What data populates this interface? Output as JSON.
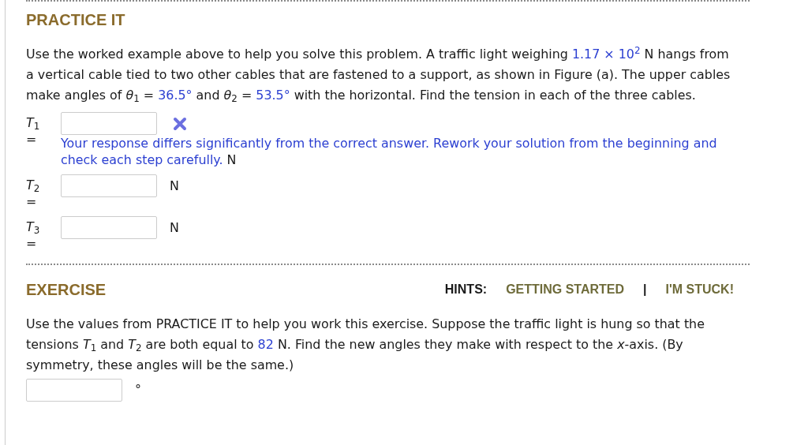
{
  "practice": {
    "title": "PRACTICE IT",
    "paragraph": [
      {
        "kind": "plain",
        "text": "Use the worked example above to help you solve this problem. A traffic light weighing "
      },
      {
        "kind": "value",
        "text": "1.17 × 10$^{2}$"
      },
      {
        "kind": "plain",
        "text": " N hangs from a vertical cable tied to two other cables that are fastened to a support, as shown in Figure (a). The upper cables make angles of *θ*$_{1}$ = "
      },
      {
        "kind": "value",
        "text": "36.5°"
      },
      {
        "kind": "plain",
        "text": " and *θ*$_{2}$ = "
      },
      {
        "kind": "value",
        "text": "53.5°"
      },
      {
        "kind": "plain",
        "text": " with the horizontal. Find the tension in each of the three cables."
      }
    ],
    "answers": [
      {
        "label": "*T*$_{1}$ =",
        "incorrect": true,
        "feedback": "Your response differs significantly from the correct answer. Rework your solution from the beginning and check each step carefully.",
        "unit": "N"
      },
      {
        "label": "*T*$_{2}$ =",
        "incorrect": false,
        "unit": "N"
      },
      {
        "label": "*T*$_{3}$ =",
        "incorrect": false,
        "unit": "N"
      }
    ]
  },
  "exercise": {
    "title": "EXERCISE",
    "hints_label": "HINTS:",
    "hints": [
      "GETTING STARTED",
      "I'M STUCK!"
    ],
    "hint_separator": "|",
    "paragraph": [
      {
        "kind": "plain",
        "text": "Use the values from PRACTICE IT to help you work this exercise. Suppose the traffic light is hung so that the tensions *T*$_{1}$ and *T*$_{2}$ are both equal to "
      },
      {
        "kind": "value",
        "text": "82"
      },
      {
        "kind": "plain",
        "text": " N. Find the new angles they make with respect to the *x*-axis. (By symmetry, these angles will be the same.)"
      }
    ],
    "answer": {
      "unit": "°"
    }
  }
}
